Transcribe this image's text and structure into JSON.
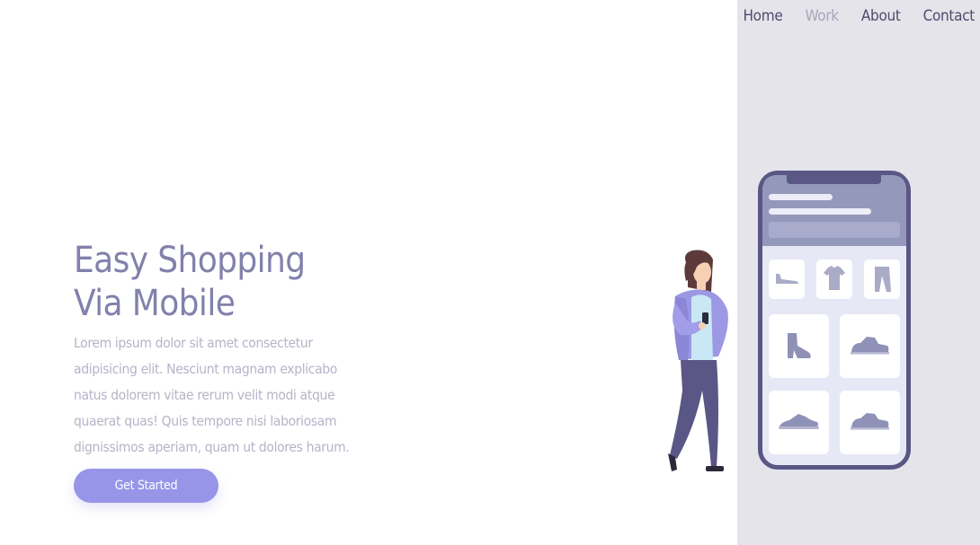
{
  "nav": {
    "items": [
      {
        "label": "Home",
        "state": "default"
      },
      {
        "label": "Work",
        "state": "muted"
      },
      {
        "label": "About",
        "state": "default"
      },
      {
        "label": "Contact",
        "state": "default"
      }
    ]
  },
  "hero": {
    "title_line1": "Easy Shopping",
    "title_line2": "Via Mobile",
    "text": "Lorem ipsum dolor sit amet consectetur adipisicing elit. Nesciunt magnam explicabo natus dolorem vitae rerum velit modi atque quaerat quas! Quis tempore nisi laboriosam dignissimos aperiam, quam ut dolores harum.",
    "cta_label": "Get Started"
  },
  "illustration": {
    "phone_categories": [
      "shoe-icon",
      "tshirt-icon",
      "pants-icon"
    ],
    "phone_products": [
      "boot-icon",
      "sneaker-icon",
      "running-shoe-icon",
      "sneaker-icon"
    ]
  },
  "colors": {
    "accent": "#9695e8",
    "title": "#8281ab",
    "body_text": "#b5b4c8",
    "panel_bg": "#e5e4ea",
    "phone_frame": "#5a5685"
  }
}
